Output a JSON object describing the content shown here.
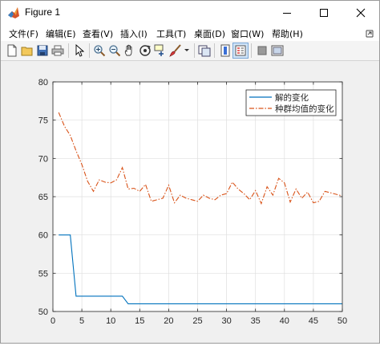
{
  "window": {
    "title": "Figure 1",
    "controls": {
      "minimize": "—",
      "maximize": "☐",
      "close": "✕"
    }
  },
  "menu": {
    "items": [
      {
        "label": "文件(F)"
      },
      {
        "label": "编辑(E)"
      },
      {
        "label": "查看(V)"
      },
      {
        "label": "插入(I)"
      },
      {
        "label": "工具(T)"
      },
      {
        "label": "桌面(D)"
      },
      {
        "label": "窗口(W)"
      },
      {
        "label": "帮助(H)"
      }
    ],
    "dock_icon": "dock-arrow-icon"
  },
  "toolbar": {
    "icons": [
      "new-figure-icon",
      "open-file-icon",
      "save-icon",
      "print-icon",
      "select-pointer-icon",
      "zoom-in-icon",
      "zoom-out-icon",
      "pan-hand-icon",
      "rotate-3d-icon",
      "data-cursor-icon",
      "brush-icon",
      "brush-dropdown-icon",
      "link-plot-icon",
      "insert-colorbar-icon",
      "insert-legend-icon",
      "hide-plot-tools-icon",
      "show-plot-tools-icon"
    ]
  },
  "chart_data": {
    "type": "line",
    "title": "",
    "xlabel": "",
    "ylabel": "",
    "xlim": [
      0,
      50
    ],
    "ylim": [
      50,
      80
    ],
    "xticks": [
      0,
      5,
      10,
      15,
      20,
      25,
      30,
      35,
      40,
      45,
      50
    ],
    "yticks": [
      50,
      55,
      60,
      65,
      70,
      75,
      80
    ],
    "grid": true,
    "legend_position": "top-right",
    "colors": {
      "solution": "#0072bd",
      "mean": "#d95319",
      "axes": "#262626",
      "grid": "#dfdfdf"
    },
    "series": [
      {
        "name": "解的变化",
        "style": "solid",
        "x": [
          1,
          2,
          3,
          4,
          5,
          6,
          7,
          8,
          9,
          10,
          11,
          12,
          13,
          14,
          15,
          16,
          17,
          18,
          19,
          20,
          21,
          22,
          23,
          24,
          25,
          26,
          27,
          28,
          29,
          30,
          31,
          32,
          33,
          34,
          35,
          36,
          37,
          38,
          39,
          40,
          41,
          42,
          43,
          44,
          45,
          46,
          47,
          48,
          49,
          50
        ],
        "values": [
          60,
          60,
          60,
          52,
          52,
          52,
          52,
          52,
          52,
          52,
          52,
          52,
          51,
          51,
          51,
          51,
          51,
          51,
          51,
          51,
          51,
          51,
          51,
          51,
          51,
          51,
          51,
          51,
          51,
          51,
          51,
          51,
          51,
          51,
          51,
          51,
          51,
          51,
          51,
          51,
          51,
          51,
          51,
          51,
          51,
          51,
          51,
          51,
          51,
          51
        ]
      },
      {
        "name": "种群均值的变化",
        "style": "dash-dot",
        "x": [
          1,
          2,
          3,
          4,
          5,
          6,
          7,
          8,
          9,
          10,
          11,
          12,
          13,
          14,
          15,
          16,
          17,
          18,
          19,
          20,
          21,
          22,
          23,
          24,
          25,
          26,
          27,
          28,
          29,
          30,
          31,
          32,
          33,
          34,
          35,
          36,
          37,
          38,
          39,
          40,
          41,
          42,
          43,
          44,
          45,
          46,
          47,
          48,
          49,
          50
        ],
        "values": [
          76,
          74.2,
          73,
          71,
          69.2,
          67,
          65.7,
          67.2,
          66.9,
          66.8,
          67.2,
          68.8,
          66,
          66.1,
          65.7,
          66.6,
          64.4,
          64.6,
          64.8,
          66.5,
          64.2,
          65.2,
          64.8,
          64.6,
          64.4,
          65.2,
          64.8,
          64.6,
          65.2,
          65.4,
          66.9,
          66,
          65.4,
          64.6,
          65.8,
          64.1,
          66.3,
          65.2,
          67.4,
          66.8,
          64.3,
          66,
          64.8,
          65.6,
          64.2,
          64.4,
          65.7,
          65.5,
          65.3,
          65.1
        ]
      }
    ]
  }
}
